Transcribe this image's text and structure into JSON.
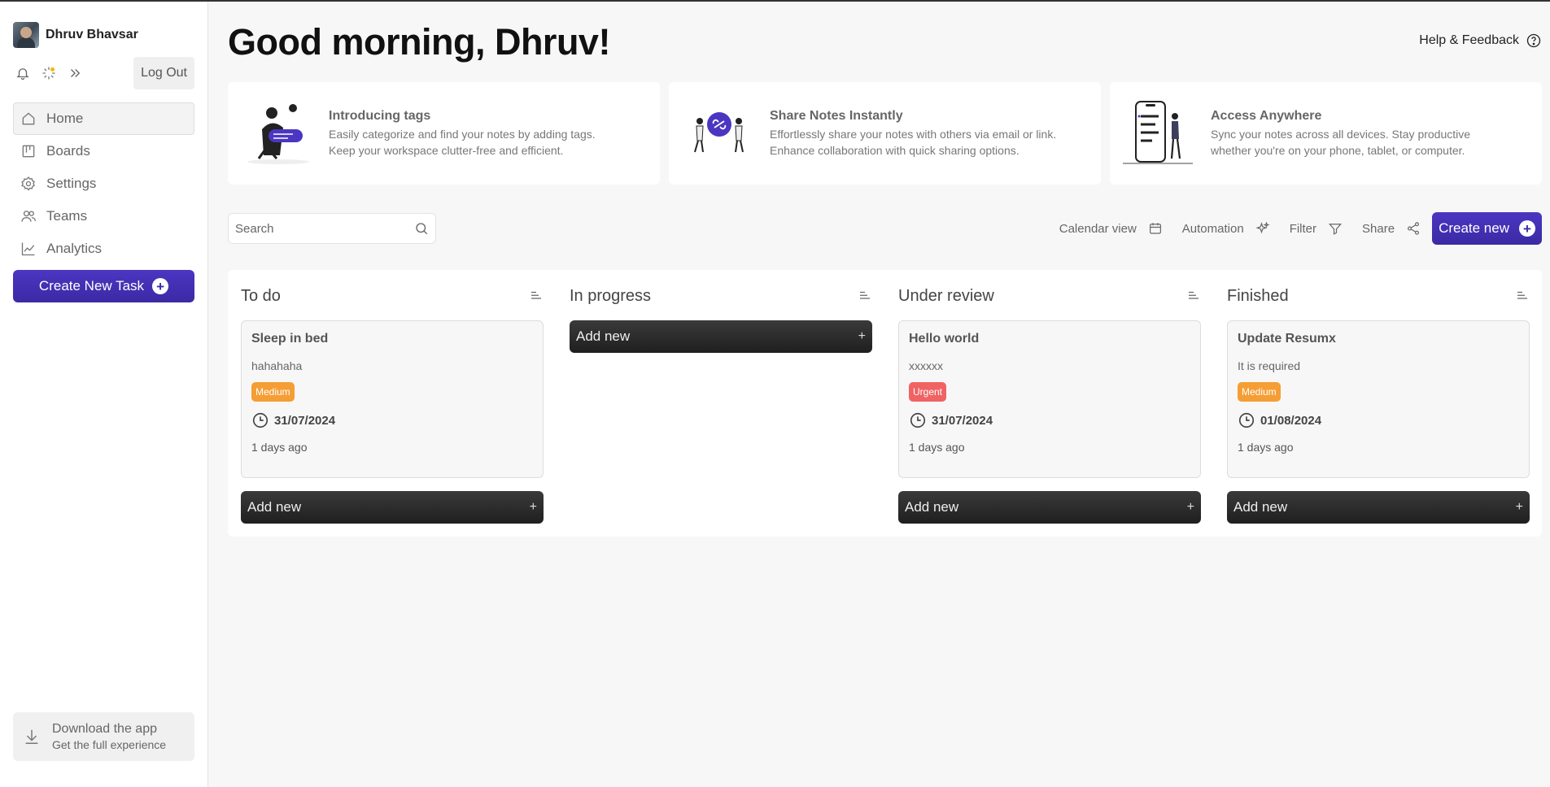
{
  "user": {
    "name": "Dhruv Bhavsar"
  },
  "sidebar": {
    "logout_label": "Log Out",
    "items": [
      {
        "label": "Home",
        "icon": "home-icon",
        "active": true
      },
      {
        "label": "Boards",
        "icon": "boards-icon"
      },
      {
        "label": "Settings",
        "icon": "gear-icon"
      },
      {
        "label": "Teams",
        "icon": "users-icon"
      },
      {
        "label": "Analytics",
        "icon": "chart-icon"
      }
    ],
    "create_task_label": "Create New Task",
    "download": {
      "title": "Download the app",
      "subtitle": "Get the full experience"
    }
  },
  "header": {
    "greeting": "Good morning, Dhruv!",
    "help_label": "Help & Feedback"
  },
  "promos": [
    {
      "title": "Introducing tags",
      "line1": "Easily categorize and find your notes by adding tags.",
      "line2": "Keep your workspace clutter-free and efficient."
    },
    {
      "title": "Share Notes Instantly",
      "line1": "Effortlessly share your notes with others via email or link.",
      "line2": "Enhance collaboration with quick sharing options."
    },
    {
      "title": "Access Anywhere",
      "line1": "Sync your notes across all devices. Stay productive",
      "line2": "whether you're on your phone, tablet, or computer."
    }
  ],
  "toolbar": {
    "search_placeholder": "Search",
    "calendar_label": "Calendar view",
    "automation_label": "Automation",
    "filter_label": "Filter",
    "share_label": "Share",
    "create_new_label": "Create new"
  },
  "colors": {
    "accent": "#3a2aa4",
    "medium": "#f59e35",
    "urgent": "#f06363"
  },
  "board": {
    "add_new_label": "Add new",
    "columns": [
      {
        "title": "To do",
        "card": {
          "title": "Sleep in bed",
          "desc": "hahahaha",
          "priority": "Medium",
          "date": "31/07/2024",
          "ago": "1 days ago"
        }
      },
      {
        "title": "In progress"
      },
      {
        "title": "Under review",
        "card": {
          "title": "Hello world",
          "desc": "xxxxxx",
          "priority": "Urgent",
          "date": "31/07/2024",
          "ago": "1 days ago"
        }
      },
      {
        "title": "Finished",
        "card": {
          "title": "Update Resumx",
          "desc": "It is required",
          "priority": "Medium",
          "date": "01/08/2024",
          "ago": "1 days ago"
        }
      }
    ]
  }
}
